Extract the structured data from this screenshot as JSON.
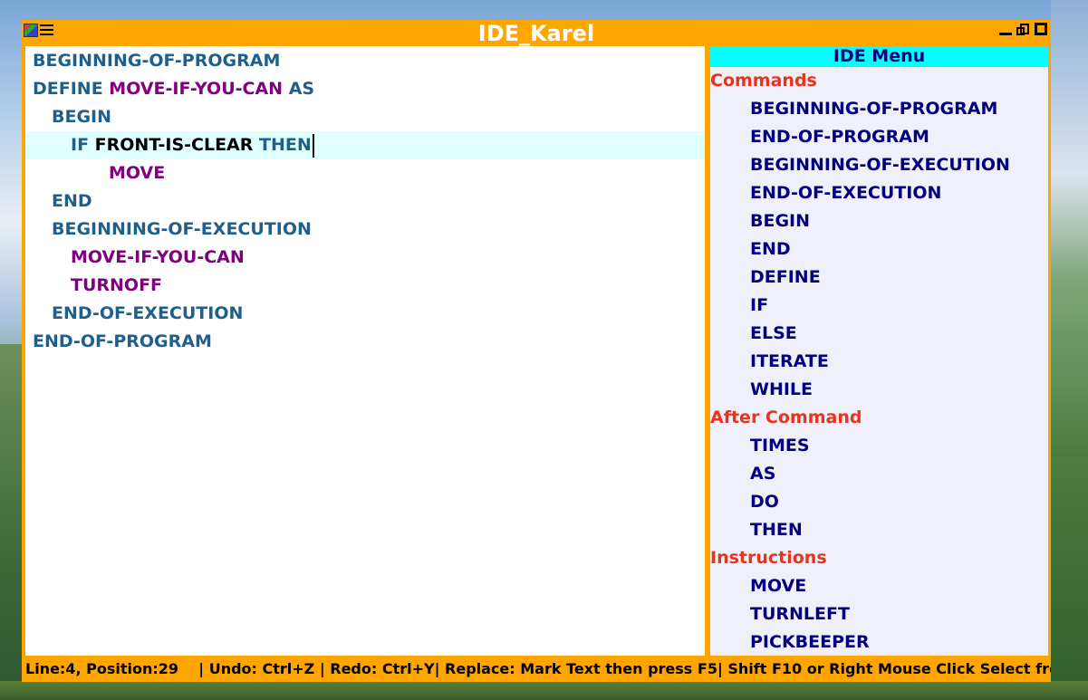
{
  "window": {
    "title": "IDE_Karel"
  },
  "editor": {
    "lines": [
      {
        "indent": 0,
        "parts": [
          {
            "t": "BEGINNING-OF-PROGRAM",
            "c": "kw"
          }
        ]
      },
      {
        "indent": 0,
        "parts": [
          {
            "t": "DEFINE ",
            "c": "kw"
          },
          {
            "t": "MOVE-IF-YOU-CAN",
            "c": "ident"
          },
          {
            "t": " AS",
            "c": "kw"
          }
        ]
      },
      {
        "indent": 1,
        "parts": [
          {
            "t": "BEGIN",
            "c": "kw"
          }
        ]
      },
      {
        "indent": 2,
        "current": true,
        "parts": [
          {
            "t": "IF ",
            "c": "kw"
          },
          {
            "t": "FRONT-IS-CLEAR",
            "c": "cond"
          },
          {
            "t": " THEN",
            "c": "kw"
          }
        ]
      },
      {
        "indent": 4,
        "parts": [
          {
            "t": "MOVE",
            "c": "ident"
          }
        ]
      },
      {
        "indent": 1,
        "parts": [
          {
            "t": "END",
            "c": "kw"
          }
        ]
      },
      {
        "indent": 1,
        "parts": [
          {
            "t": "BEGINNING-OF-EXECUTION",
            "c": "kw"
          }
        ]
      },
      {
        "indent": 2,
        "parts": [
          {
            "t": "MOVE-IF-YOU-CAN",
            "c": "ident"
          }
        ]
      },
      {
        "indent": 2,
        "parts": [
          {
            "t": "TURNOFF",
            "c": "ident"
          }
        ]
      },
      {
        "indent": 1,
        "parts": [
          {
            "t": "END-OF-EXECUTION",
            "c": "kw"
          }
        ]
      },
      {
        "indent": 0,
        "parts": [
          {
            "t": "END-OF-PROGRAM",
            "c": "kw"
          }
        ]
      }
    ]
  },
  "side_menu": {
    "header": "IDE Menu",
    "rows": [
      {
        "type": "section",
        "label": "Commands"
      },
      {
        "type": "item",
        "label": "BEGINNING-OF-PROGRAM"
      },
      {
        "type": "item",
        "label": "END-OF-PROGRAM"
      },
      {
        "type": "item",
        "label": "BEGINNING-OF-EXECUTION"
      },
      {
        "type": "item",
        "label": "END-OF-EXECUTION"
      },
      {
        "type": "item",
        "label": "BEGIN"
      },
      {
        "type": "item",
        "label": "END"
      },
      {
        "type": "item",
        "label": "DEFINE"
      },
      {
        "type": "item",
        "label": "IF"
      },
      {
        "type": "item",
        "label": "ELSE"
      },
      {
        "type": "item",
        "label": "ITERATE"
      },
      {
        "type": "item",
        "label": "WHILE"
      },
      {
        "type": "section",
        "label": "After Command"
      },
      {
        "type": "item",
        "label": "TIMES"
      },
      {
        "type": "item",
        "label": "AS"
      },
      {
        "type": "item",
        "label": "DO"
      },
      {
        "type": "item",
        "label": "THEN"
      },
      {
        "type": "section",
        "label": "Instructions"
      },
      {
        "type": "item",
        "label": "MOVE"
      },
      {
        "type": "item",
        "label": "TURNLEFT"
      },
      {
        "type": "item",
        "label": "PICKBEEPER"
      }
    ]
  },
  "statusbar": {
    "text": "Line:4, Position:29    | Undo: Ctrl+Z | Redo: Ctrl+Y| Replace: Mark Text then press F5| Shift F10 or Right Mouse Click Select from I"
  },
  "colors": {
    "frame": "#ffa500",
    "keyword": "#1f5f8b",
    "identifier": "#800080",
    "section": "#e8341c",
    "menu_item": "#000080",
    "menu_header_bg": "#00ffff",
    "current_line_bg": "#e0ffff"
  },
  "icons": [
    "app-icon",
    "hamburger-menu-icon",
    "minimize-icon",
    "restore-icon",
    "maximize-icon"
  ]
}
